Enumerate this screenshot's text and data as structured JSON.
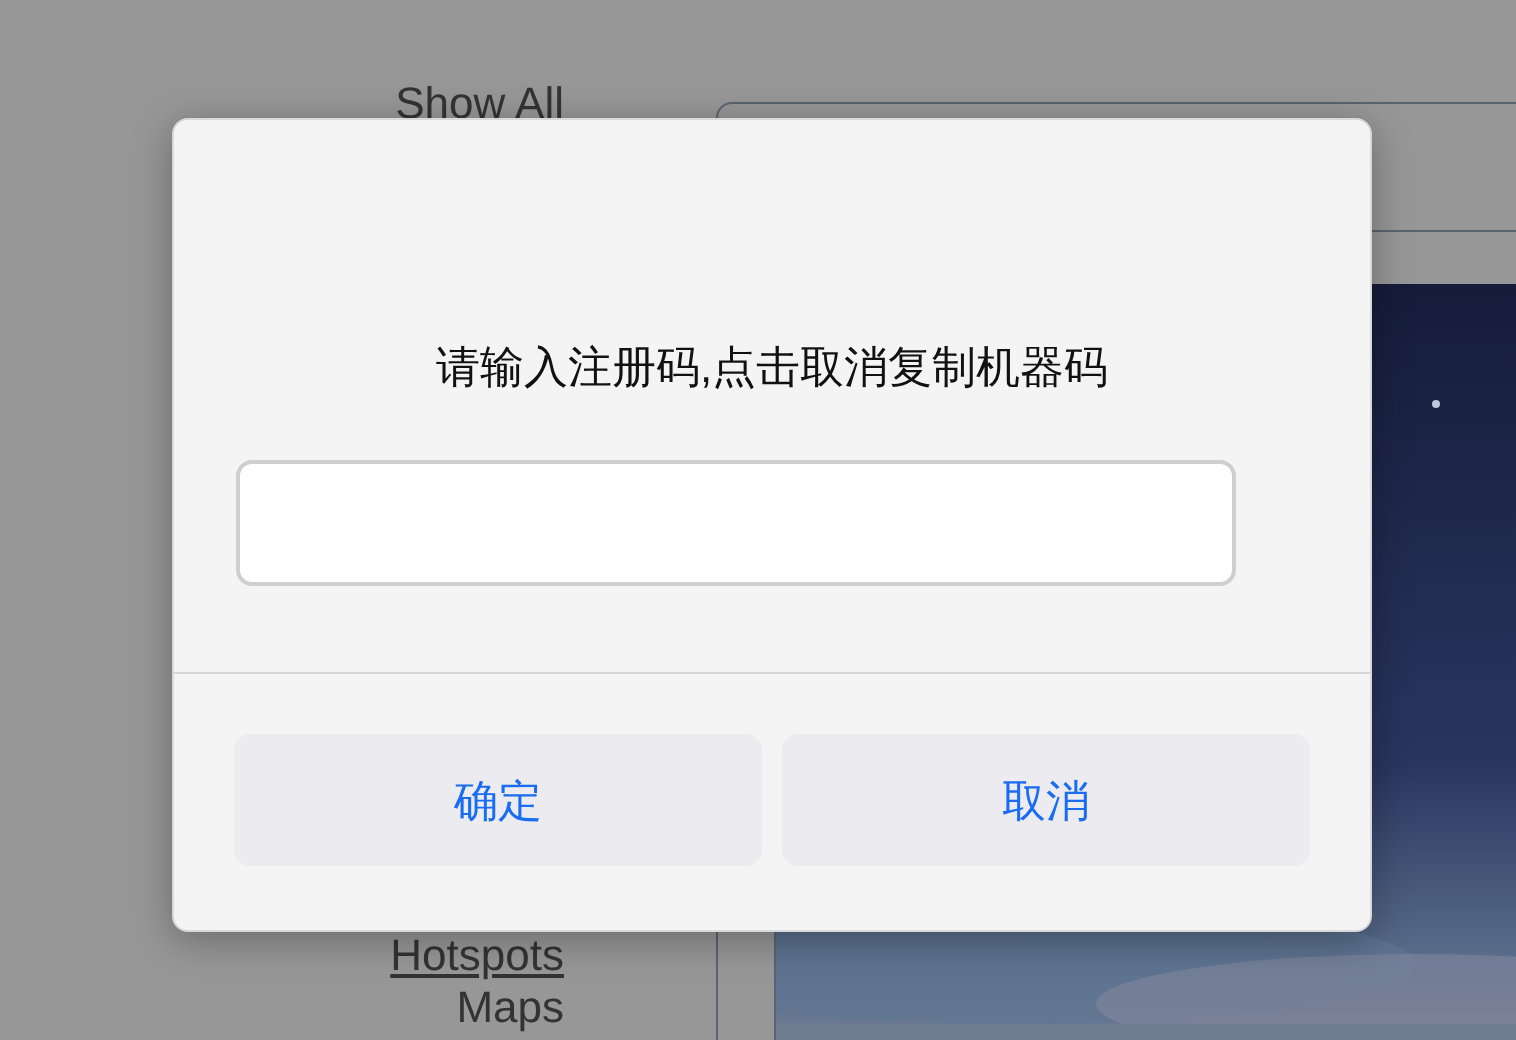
{
  "page": {
    "nav_links": [
      {
        "label": "Show All",
        "kind": "plain"
      },
      {
        "label": "Hotspots",
        "kind": "link"
      },
      {
        "label": "Maps",
        "kind": "plain"
      }
    ]
  },
  "dialog": {
    "message": "请输入注册码,点击取消复制机器码",
    "buttons": [
      {
        "label": "确定"
      },
      {
        "label": "取消"
      }
    ]
  }
}
